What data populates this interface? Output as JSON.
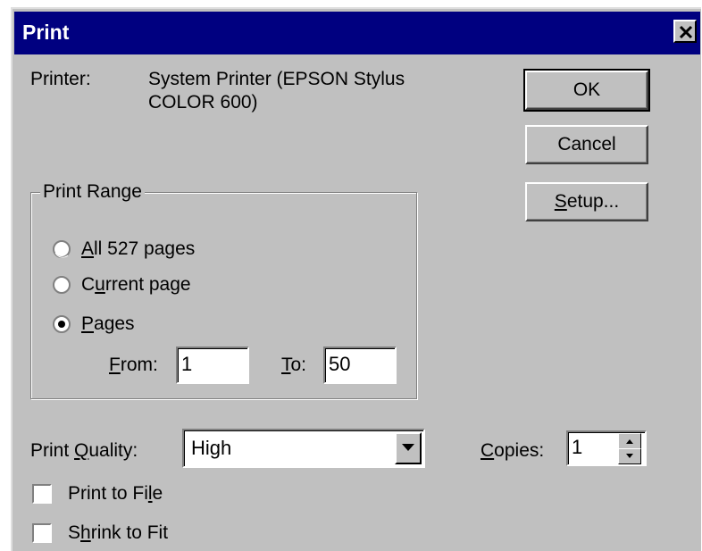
{
  "window": {
    "title": "Print"
  },
  "printer": {
    "label": "Printer:",
    "value_line1": "System Printer (EPSON Stylus",
    "value_line2": "COLOR 600)"
  },
  "buttons": {
    "ok": "OK",
    "cancel": "Cancel",
    "setup_mnemonic": "S",
    "setup_rest": "etup..."
  },
  "print_range": {
    "legend": "Print Range",
    "options": [
      {
        "mnemonic": "A",
        "rest": "ll 527 pages",
        "selected": false
      },
      {
        "pre": "C",
        "mnemonic": "u",
        "rest": "rrent page",
        "selected": false
      },
      {
        "mnemonic": "P",
        "rest": "ages",
        "selected": true
      }
    ],
    "from_label_mnemonic": "F",
    "from_label_rest": "rom:",
    "from_value": "1",
    "to_label_mnemonic": "T",
    "to_label_rest": "o:",
    "to_value": "50"
  },
  "quality": {
    "label_pre": "Print ",
    "label_mnemonic": "Q",
    "label_rest": "uality:",
    "selected": "High"
  },
  "copies": {
    "label_mnemonic": "C",
    "label_rest": "opies:",
    "value": "1"
  },
  "checkboxes": {
    "print_to_file": {
      "pre": "Print to Fi",
      "mnemonic": "l",
      "rest": "e",
      "checked": false
    },
    "shrink_to_fit": {
      "pre": "S",
      "mnemonic": "h",
      "rest": "rink to Fit",
      "checked": false
    }
  }
}
